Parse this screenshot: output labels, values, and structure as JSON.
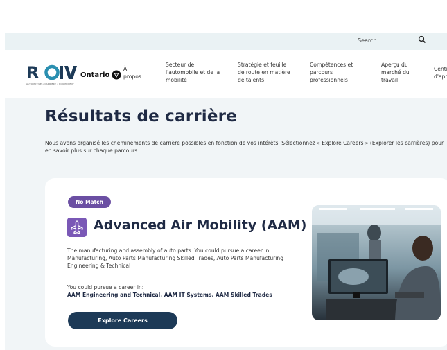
{
  "topbar": {
    "search_label": "Search",
    "search_icon": "search-icon"
  },
  "header": {
    "logo_text": "ROIV",
    "logo_subtext": "AUTOMOTIVE • CARRIERE • ÉQUIPEMENT",
    "ontario_label": "Ontario",
    "nav_items": [
      {
        "label": "À\npropos"
      },
      {
        "label": "Secteur de\nl'automobile et de la\nmobilité"
      },
      {
        "label": "Stratégie et feuille\nde route en matière\nde talents"
      },
      {
        "label": "Compétences et\nparcours\nprofessionnels"
      },
      {
        "label": "Aperçu du\nmarché du\ntravail"
      },
      {
        "label": "Centre\nd'appr"
      }
    ]
  },
  "main": {
    "title": "Résultats de carrière",
    "intro": "Nous avons organisé les cheminements de carrière possibles en fonction de vos intérêts. Sélectionnez « Explore Careers » (Explorer les carrières) pour en savoir plus sur chaque parcours."
  },
  "card": {
    "badge": "No Match",
    "icon": "aircraft-icon",
    "title": "Advanced Air Mobility (AAM)",
    "description": "The manufacturing and assembly of auto parts. You could pursue a career in: Manufacturing, Auto Parts Manufacturing Skilled Trades, Auto Parts Manufacturing Engineering & Technical",
    "pursue_label": "You could pursue a career in:",
    "pursue_list": "AAM Engineering and Technical, AAM IT Systems, AAM Skilled Trades",
    "button_label": "Explore Careers",
    "photo": "engineer-at-computer-photo"
  },
  "colors": {
    "topbar_bg": "#eaf2f4",
    "main_bg": "#f1f5f7",
    "title_text": "#1f2a44",
    "badge_purple": "#6b4fa3",
    "button_navy": "#1d3a57"
  }
}
